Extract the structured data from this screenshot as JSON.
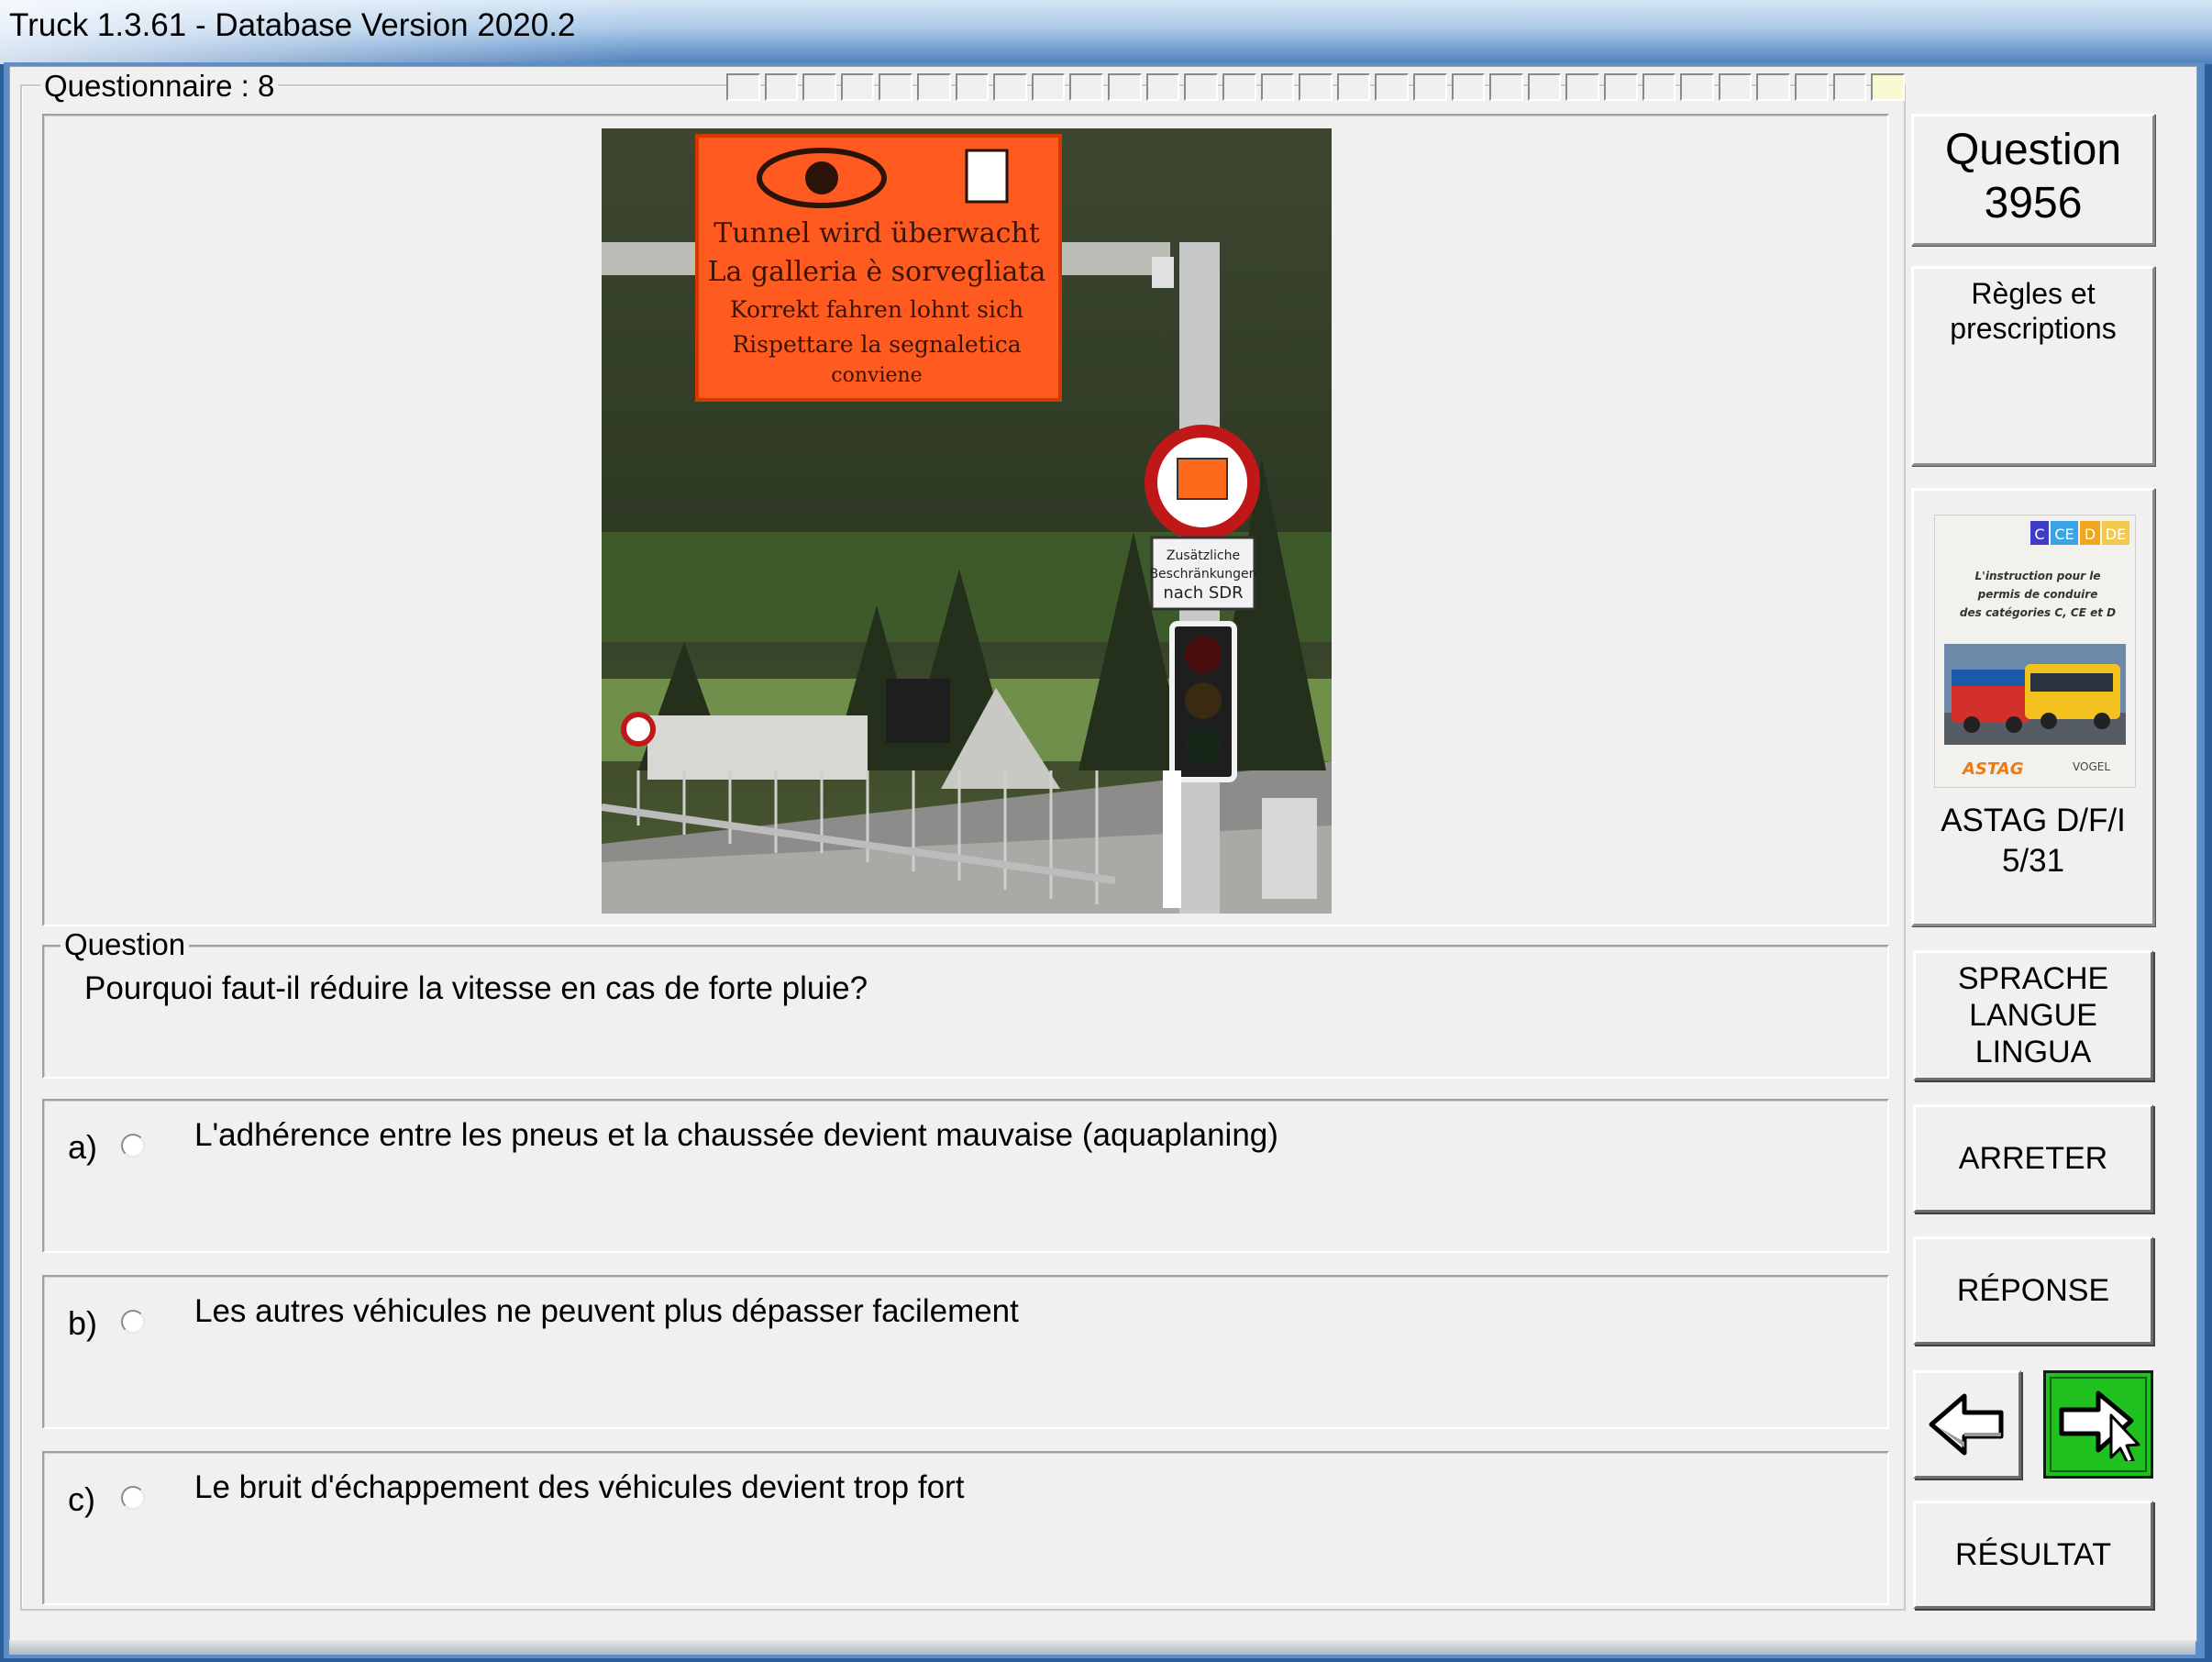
{
  "window": {
    "title": "Truck 1.3.61 - Database Version 2020.2"
  },
  "questionnaire": {
    "label": "Questionnaire : 8",
    "progress_cells": 31,
    "current_cell": 31
  },
  "image": {
    "description_icon": "tunnel-sign-photo",
    "sign_lines": [
      "Tunnel wird überwacht",
      "La galleria è sorvegliata",
      "Korrekt fahren lohnt sich",
      "Rispettare la segnaletica",
      "conviene"
    ],
    "plate_lines": [
      "Zusätzliche",
      "Beschränkungen",
      "nach SDR"
    ]
  },
  "question": {
    "legend": "Question",
    "text": "Pourquoi faut-il réduire la vitesse en cas de forte pluie?"
  },
  "answers": [
    {
      "letter": "a)",
      "text": "L'adhérence entre les pneus et la chaussée devient mauvaise (aquaplaning)",
      "selected": false
    },
    {
      "letter": "b)",
      "text": "Les autres véhicules ne peuvent plus dépasser facilement",
      "selected": false
    },
    {
      "letter": "c)",
      "text": "Le bruit d'échappement des véhicules devient trop fort",
      "selected": false
    }
  ],
  "sidebar": {
    "question_label": "Question",
    "question_number": "3956",
    "category_line1": "Règles et",
    "category_line2": "prescriptions",
    "book": {
      "badges": [
        "C",
        "CE",
        "D",
        "DE"
      ],
      "cover_text_1": "L'instruction pour le",
      "cover_text_2": "permis de conduire",
      "cover_text_3": "des catégories C, CE et D",
      "logo_left": "ASTAG",
      "logo_right": "VOGEL",
      "label_line1": "ASTAG D/F/I",
      "label_line2": "5/31"
    },
    "buttons": {
      "lang_line1": "SPRACHE",
      "lang_line2": "LANGUE",
      "lang_line3": "LINGUA",
      "stop": "ARRETER",
      "answer": "RÉPONSE",
      "result": "RÉSULTAT",
      "prev_icon": "arrow-left-icon",
      "next_icon": "arrow-right-icon"
    }
  },
  "colors": {
    "next_button": "#1fc11f",
    "sign_orange": "#ff5a1f"
  }
}
